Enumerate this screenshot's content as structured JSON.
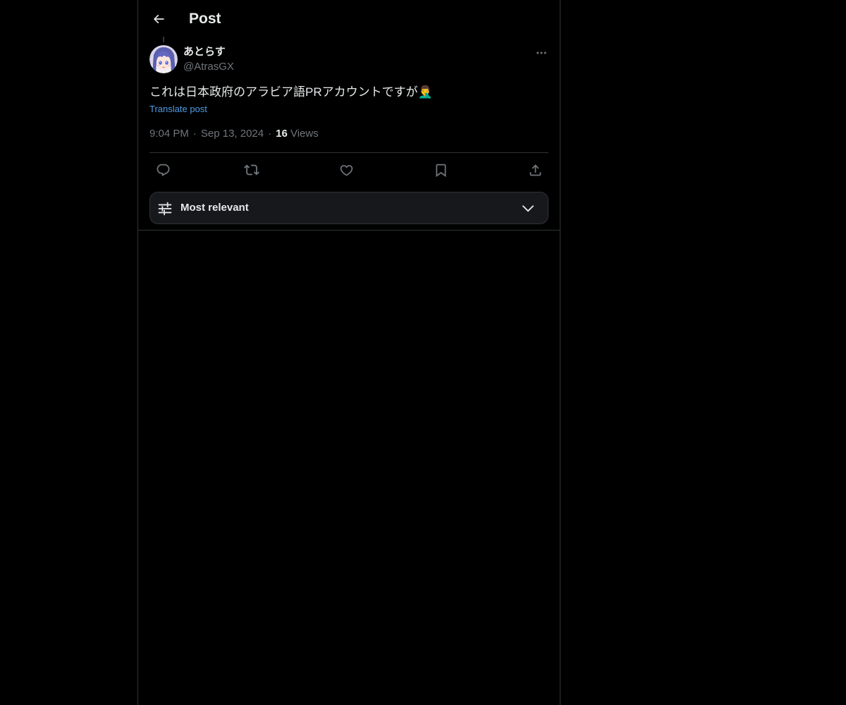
{
  "header": {
    "back_icon": "arrow-left-icon",
    "title": "Post"
  },
  "post": {
    "author": {
      "display_name": "あとらす",
      "handle": "@AtrasGX",
      "avatar_icon": "avatar-image"
    },
    "more_icon": "ellipsis-icon",
    "text": "これは日本政府のアラビア語PRアカウントですが",
    "emoji": "🤦‍♂️",
    "translate_label": "Translate post",
    "time": "9:04 PM",
    "date": "Sep 13, 2024",
    "views_count": "16",
    "views_label": "Views",
    "separator": "·"
  },
  "actions": [
    {
      "name": "reply",
      "icon": "reply-icon"
    },
    {
      "name": "repost",
      "icon": "repost-icon"
    },
    {
      "name": "like",
      "icon": "heart-icon"
    },
    {
      "name": "bookmark",
      "icon": "bookmark-icon"
    },
    {
      "name": "share",
      "icon": "share-icon"
    }
  ],
  "sort": {
    "label": "Most relevant",
    "icon": "sliders-icon",
    "chevron_icon": "chevron-down-icon"
  },
  "colors": {
    "background": "#000000",
    "text_primary": "#e7e9ea",
    "text_secondary": "#71767b",
    "link": "#4f9ee8",
    "border": "#2f3336"
  }
}
